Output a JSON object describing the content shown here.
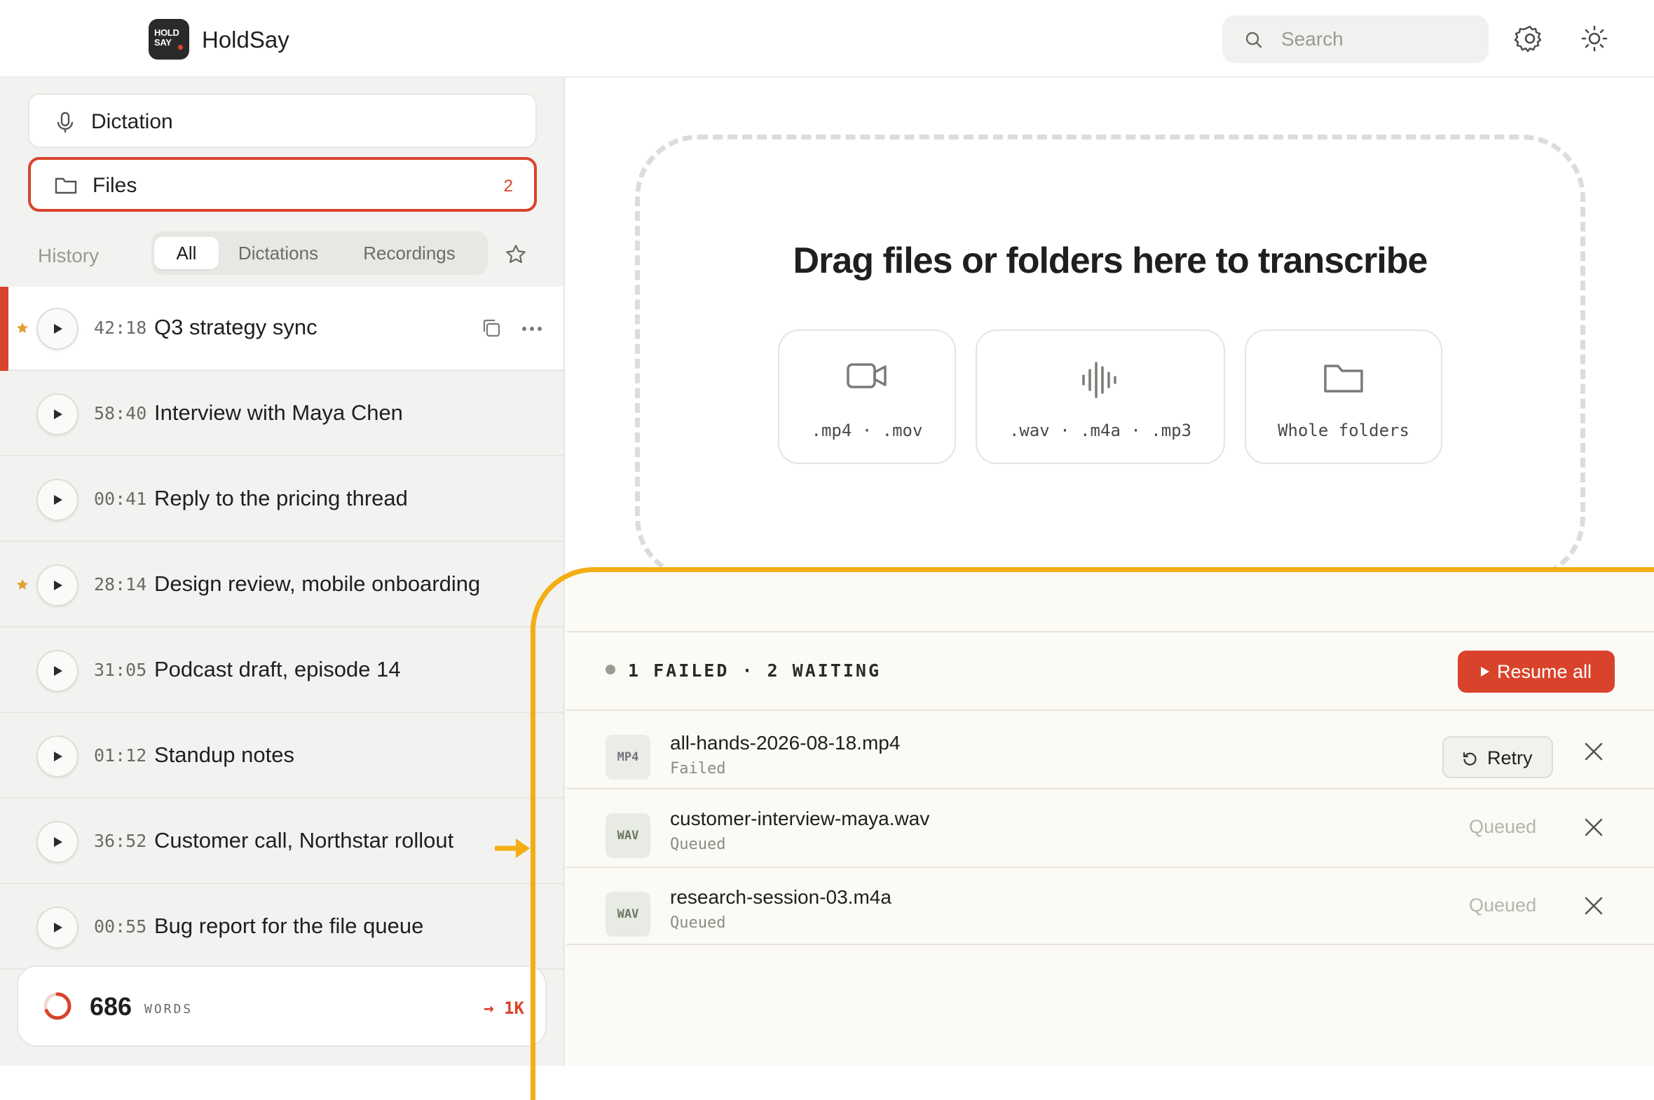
{
  "app": {
    "name": "HoldSay",
    "logo_text_line1": "HOLD",
    "logo_text_line2": "SAY"
  },
  "header": {
    "search_placeholder": "Search",
    "icons": [
      "search-icon",
      "gear-icon",
      "sun-icon"
    ]
  },
  "sidebar": {
    "nav": [
      {
        "label": "Dictation",
        "icon": "microphone-icon",
        "active": false
      },
      {
        "label": "Files",
        "icon": "folder-icon",
        "active": true,
        "badge": "2"
      }
    ],
    "history_label": "History",
    "filters": [
      "All",
      "Dictations",
      "Recordings"
    ],
    "selected_filter": "All",
    "items": [
      {
        "duration": "42:18",
        "title": "Q3 strategy sync",
        "starred": true,
        "active": true
      },
      {
        "duration": "58:40",
        "title": "Interview with Maya Chen",
        "starred": false
      },
      {
        "duration": "00:41",
        "title": "Reply to the pricing thread",
        "starred": false
      },
      {
        "duration": "28:14",
        "title": "Design review, mobile onboarding",
        "starred": true
      },
      {
        "duration": "31:05",
        "title": "Podcast draft, episode 14",
        "starred": false
      },
      {
        "duration": "01:12",
        "title": "Standup notes",
        "starred": false
      },
      {
        "duration": "36:52",
        "title": "Customer call, Northstar rollout",
        "starred": false
      },
      {
        "duration": "00:55",
        "title": "Bug report for the file queue",
        "starred": false
      }
    ],
    "words": {
      "count": "686",
      "unit": "WORDS",
      "goal": "→ 1K",
      "progress": 0.686
    }
  },
  "main": {
    "drop_title": "Drag files or folders here to transcribe",
    "types": [
      {
        "label": ".mp4 · .mov",
        "icon": "video-icon"
      },
      {
        "label": ".wav · .m4a · .mp3",
        "icon": "waveform-icon"
      },
      {
        "label": "Whole folders",
        "icon": "folder-icon"
      }
    ],
    "queue": {
      "status": "1 FAILED · 2 WAITING",
      "resume_label": "Resume all",
      "retry_label": "Retry",
      "items": [
        {
          "type": "MP4",
          "name": "all-hands-2026-08-18.mp4",
          "status": "Failed"
        },
        {
          "type": "WAV",
          "name": "customer-interview-maya.wav",
          "status": "Queued",
          "state_label": "Queued"
        },
        {
          "type": "WAV",
          "name": "research-session-03.m4a",
          "status": "Queued",
          "state_label": "Queued"
        }
      ]
    }
  },
  "colors": {
    "accent": "#d9432c",
    "highlight": "#f2ae13",
    "star": "#e0a032"
  }
}
